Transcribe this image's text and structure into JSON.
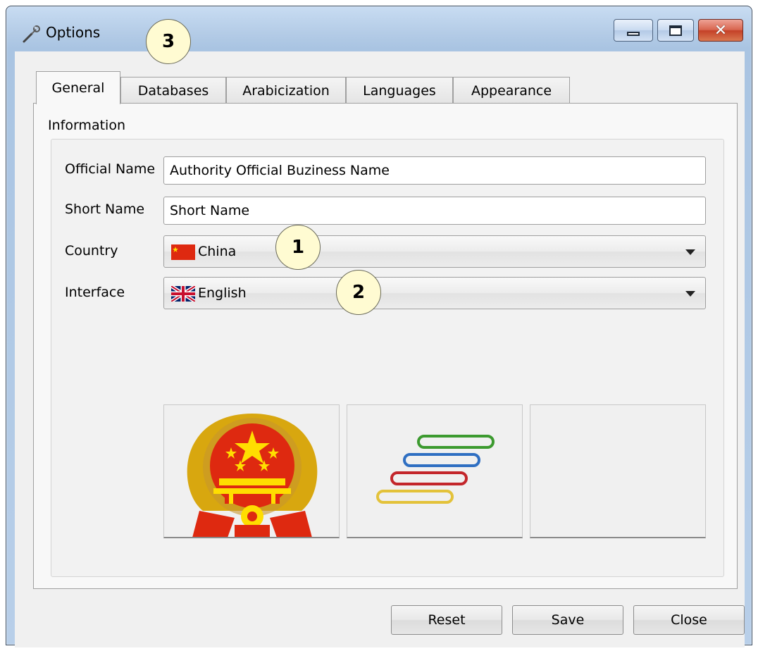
{
  "window": {
    "title": "Options",
    "title_icon": "wrench-icon"
  },
  "title_buttons": {
    "minimize": "minimize-icon",
    "maximize": "maximize-icon",
    "close": "close-icon"
  },
  "tabs": [
    {
      "label": "General",
      "active": true
    },
    {
      "label": "Databases",
      "active": false
    },
    {
      "label": "Arabicization",
      "active": false
    },
    {
      "label": "Languages",
      "active": false
    },
    {
      "label": "Appearance",
      "active": false
    }
  ],
  "general": {
    "group_title": "Information",
    "official_name": {
      "label": "Official Name",
      "value": "Authority Official Buziness Name"
    },
    "short_name": {
      "label": "Short Name",
      "value": "Short Name"
    },
    "country": {
      "label": "Country",
      "value": "China",
      "flag": "china-flag-icon"
    },
    "interface": {
      "label": "Interface",
      "value": "English",
      "flag": "uk-flag-icon"
    },
    "images": [
      {
        "name": "national-emblem-image"
      },
      {
        "name": "stacked-bars-logo-image"
      },
      {
        "name": "empty-image-slot"
      }
    ]
  },
  "buttons": {
    "reset": "Reset",
    "save": "Save",
    "close": "Close"
  },
  "callouts": {
    "one": "1",
    "two": "2",
    "three": "3"
  },
  "colors": {
    "callout_fill": "#fffbd2",
    "flag_red": "#de2910",
    "flag_gold": "#ffde00"
  }
}
